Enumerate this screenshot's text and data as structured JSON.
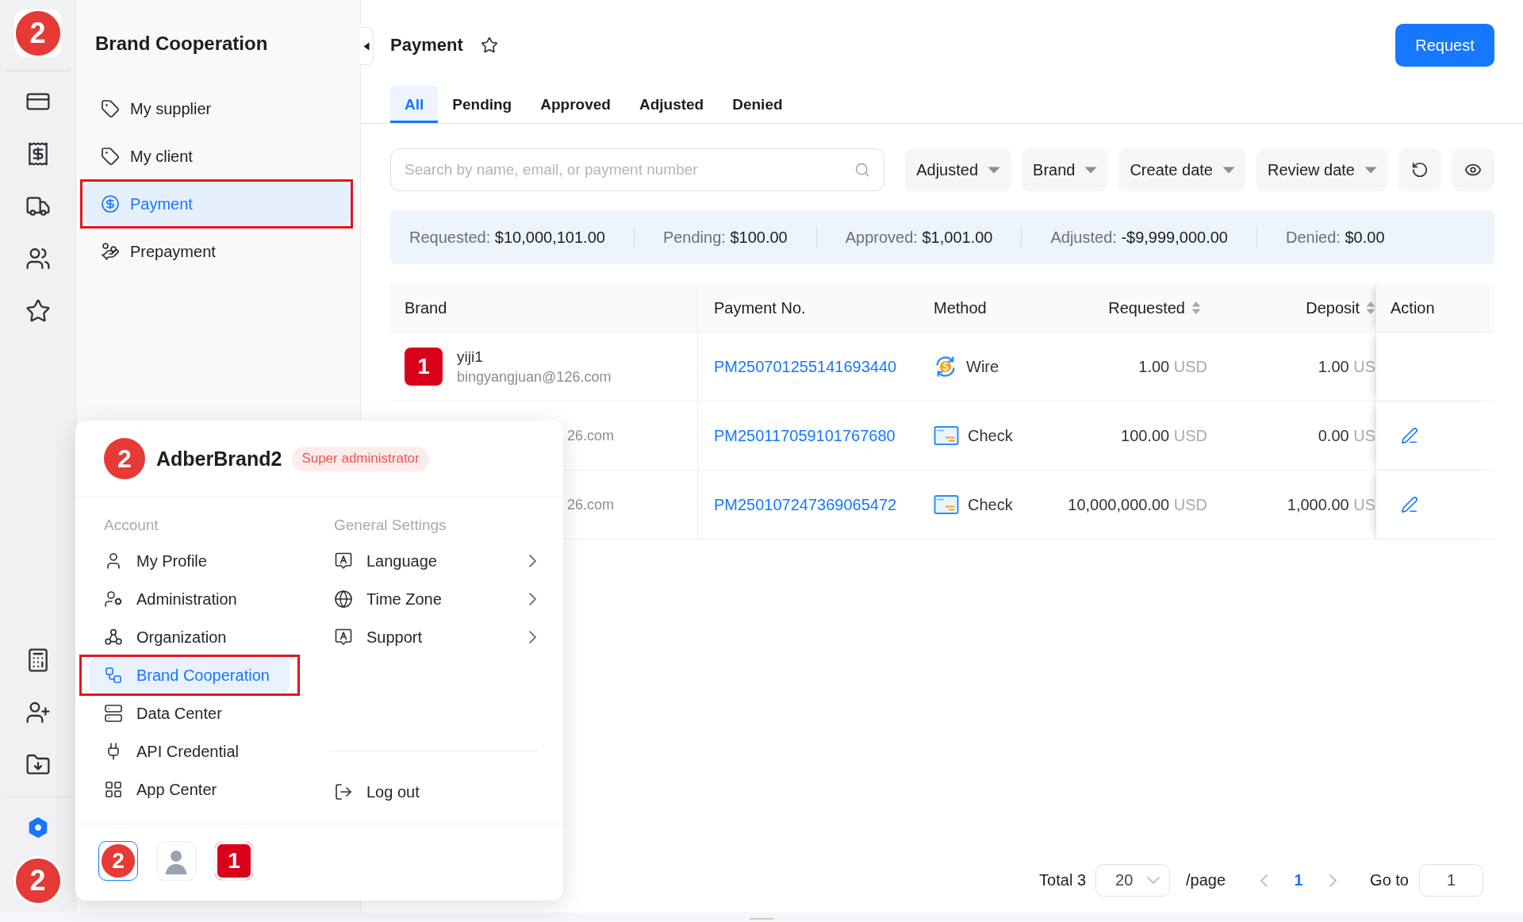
{
  "rail": {
    "logo": "2",
    "top_items": [
      {
        "selected": false
      },
      {
        "selected": false
      },
      {
        "selected": false
      },
      {
        "selected": false
      },
      {
        "selected": false
      }
    ],
    "bottom_items": [
      {
        "selected": false
      },
      {
        "selected": false
      },
      {
        "selected": false
      }
    ],
    "settings": {
      "selected": true
    },
    "avatar": "2"
  },
  "sidebar": {
    "title": "Brand Cooperation",
    "items": [
      {
        "label": "My supplier",
        "selected": false,
        "outlined": false
      },
      {
        "label": "My client",
        "selected": false,
        "outlined": false
      },
      {
        "label": "Payment",
        "selected": true,
        "outlined": true
      },
      {
        "label": "Prepayment",
        "selected": false,
        "outlined": false
      }
    ]
  },
  "header": {
    "title": "Payment",
    "starred": false,
    "action": "Request"
  },
  "tabs": [
    {
      "label": "All",
      "selected": true
    },
    {
      "label": "Pending",
      "selected": false
    },
    {
      "label": "Approved",
      "selected": false
    },
    {
      "label": "Adjusted",
      "selected": false
    },
    {
      "label": "Denied",
      "selected": false
    }
  ],
  "filters": {
    "search": {
      "placeholder": "Search by name, email, or payment number"
    },
    "dropdowns": [
      {
        "label": "Adjusted"
      },
      {
        "label": "Brand"
      },
      {
        "label": "Create date"
      },
      {
        "label": "Review date"
      }
    ]
  },
  "summary": [
    {
      "label": "Requested:",
      "value": "$10,000,101.00"
    },
    {
      "label": "Pending:",
      "value": "$100.00"
    },
    {
      "label": "Approved:",
      "value": "$1,001.00"
    },
    {
      "label": "Adjusted:",
      "value": "-$9,999,000.00"
    },
    {
      "label": "Denied:",
      "value": "$0.00"
    }
  ],
  "table": {
    "columns": [
      {
        "label": "Brand",
        "sortable": false
      },
      {
        "label": "Payment No.",
        "sortable": false
      },
      {
        "label": "Method",
        "sortable": false
      },
      {
        "label": "Requested",
        "sortable": true
      },
      {
        "label": "Deposit",
        "sortable": true
      },
      {
        "label": "Action",
        "sortable": false
      }
    ],
    "rows": [
      {
        "brand": {
          "avatar": "1",
          "name": "yiji1",
          "email": "bingyangjuan@126.com"
        },
        "payment_no": "PM250701255141693440",
        "method": {
          "kind": "wire",
          "label": "Wire"
        },
        "requested": {
          "amount": "1.00",
          "currency": "USD"
        },
        "deposit": {
          "amount": "1.00",
          "currency": "US"
        },
        "editable": false
      },
      {
        "brand": {
          "email": "26.com"
        },
        "payment_no": "PM250117059101767680",
        "method": {
          "kind": "check",
          "label": "Check"
        },
        "requested": {
          "amount": "100.00",
          "currency": "USD"
        },
        "deposit": {
          "amount": "0.00",
          "currency": "US"
        },
        "editable": true
      },
      {
        "brand": {
          "email": "26.com"
        },
        "payment_no": "PM250107247369065472",
        "method": {
          "kind": "check",
          "label": "Check"
        },
        "requested": {
          "amount": "10,000,000.00",
          "currency": "USD"
        },
        "deposit": {
          "amount": "1,000.00",
          "currency": "US"
        },
        "editable": true
      }
    ]
  },
  "pagination": {
    "total": "Total 3",
    "page_size": "20",
    "unit": "/page",
    "pages": [
      {
        "label": "1",
        "selected": true
      }
    ],
    "goto_label": "Go to",
    "goto_value": "1"
  },
  "account_menu": {
    "avatar": "2",
    "name": "AdberBrand2",
    "role": "Super administrator",
    "account": {
      "title": "Account",
      "items": [
        {
          "label": "My Profile",
          "selected": false,
          "outlined": false
        },
        {
          "label": "Administration",
          "selected": false,
          "outlined": false
        },
        {
          "label": "Organization",
          "selected": false,
          "outlined": false
        },
        {
          "label": "Brand Cooperation",
          "selected": true,
          "outlined": true
        },
        {
          "label": "Data Center",
          "selected": false,
          "outlined": false
        },
        {
          "label": "API Credential",
          "selected": false,
          "outlined": false
        },
        {
          "label": "App Center",
          "selected": false,
          "outlined": false
        }
      ]
    },
    "settings": {
      "title": "General Settings",
      "items": [
        {
          "label": "Language",
          "submenu": true
        },
        {
          "label": "Time Zone",
          "submenu": true
        },
        {
          "label": "Support",
          "submenu": true
        }
      ]
    },
    "logout": "Log out",
    "switcher": [
      {
        "kind": "circle",
        "text": "2",
        "selected": true
      },
      {
        "kind": "person",
        "selected": false
      },
      {
        "kind": "square",
        "text": "1",
        "selected": false
      }
    ]
  }
}
